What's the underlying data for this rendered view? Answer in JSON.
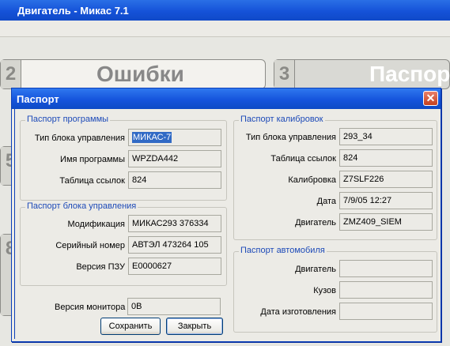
{
  "app": {
    "title": "Двигатель - Микас 7.1"
  },
  "tiles": [
    {
      "num": "2",
      "label": "Ошибки"
    },
    {
      "num": "3",
      "label": "Паспор"
    },
    {
      "num": "5",
      "label": ""
    },
    {
      "num": "8",
      "label": ""
    }
  ],
  "dialog": {
    "title": "Паспорт",
    "close_symbol": "✕",
    "program_group": {
      "title": "Паспорт программы",
      "rows": [
        {
          "label": "Тип блока управления",
          "value": "МИКАС-7"
        },
        {
          "label": "Имя программы",
          "value": "WPZDA442"
        },
        {
          "label": "Таблица ссылок",
          "value": "824"
        }
      ]
    },
    "unit_group": {
      "title": "Паспорт блока управления",
      "rows": [
        {
          "label": "Модификация",
          "value": "МИКАС293 376334"
        },
        {
          "label": "Серийный номер",
          "value": "АВТЭЛ 473264 105"
        },
        {
          "label": "Версия ПЗУ",
          "value": "E0000627"
        }
      ]
    },
    "monitor": {
      "label": "Версия монитора",
      "value": "0B"
    },
    "calib_group": {
      "title": "Паспорт калибровок",
      "rows": [
        {
          "label": "Тип блока управления",
          "value": "293_34"
        },
        {
          "label": "Таблица ссылок",
          "value": "824"
        },
        {
          "label": "Калибровка",
          "value": "Z7SLF226"
        },
        {
          "label": "Дата",
          "value": "7/9/05 12:27"
        },
        {
          "label": "Двигатель",
          "value": "ZMZ409_SIEM"
        }
      ]
    },
    "car_group": {
      "title": "Паспорт автомобиля",
      "rows": [
        {
          "label": "Двигатель",
          "value": ""
        },
        {
          "label": "Кузов",
          "value": ""
        },
        {
          "label": "Дата изготовления",
          "value": ""
        }
      ]
    },
    "buttons": {
      "save": "Сохранить",
      "close": "Закрыть"
    }
  }
}
